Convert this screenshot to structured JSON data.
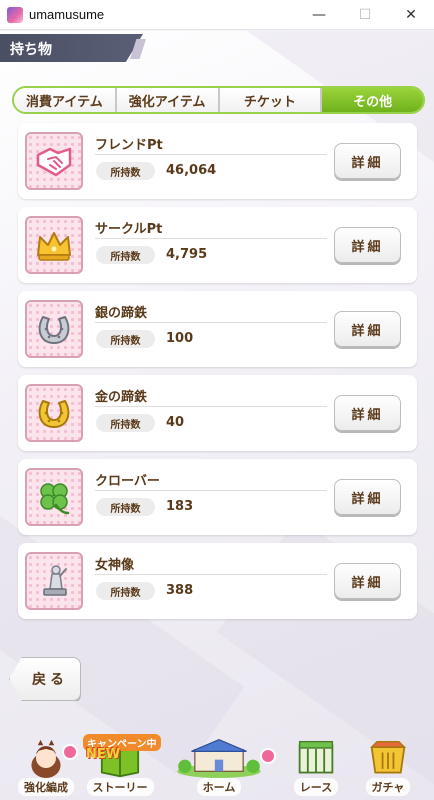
{
  "window": {
    "title": "umamusume",
    "minimize_glyph": "—",
    "maximize_glyph": "☐",
    "close_glyph": "✕"
  },
  "header": {
    "title": "持ち物"
  },
  "tabs": [
    {
      "label": "消費アイテム",
      "active": false
    },
    {
      "label": "強化アイテム",
      "active": false
    },
    {
      "label": "チケット",
      "active": false
    },
    {
      "label": "その他",
      "active": true
    }
  ],
  "items": [
    {
      "name": "フレンドPt",
      "owned_label": "所持数",
      "owned_value": "46,064",
      "detail_label": "詳細",
      "icon": "handshake-icon"
    },
    {
      "name": "サークルPt",
      "owned_label": "所持数",
      "owned_value": "4,795",
      "detail_label": "詳細",
      "icon": "crown-icon"
    },
    {
      "name": "銀の蹄鉄",
      "owned_label": "所持数",
      "owned_value": "100",
      "detail_label": "詳細",
      "icon": "silver-horseshoe-icon"
    },
    {
      "name": "金の蹄鉄",
      "owned_label": "所持数",
      "owned_value": "40",
      "detail_label": "詳細",
      "icon": "gold-horseshoe-icon"
    },
    {
      "name": "クローバー",
      "owned_label": "所持数",
      "owned_value": "183",
      "detail_label": "詳細",
      "icon": "clover-icon"
    },
    {
      "name": "女神像",
      "owned_label": "所持数",
      "owned_value": "388",
      "detail_label": "詳細",
      "icon": "goddess-statue-icon"
    }
  ],
  "back_button": {
    "label": "戻る"
  },
  "bottom_nav": [
    {
      "label": "強化編成",
      "icon": "character-icon"
    },
    {
      "label": "ストーリー",
      "icon": "book-icon",
      "badge": "キャンペーン中",
      "new": "NEW"
    },
    {
      "label": "ホーム",
      "icon": "home-building-icon"
    },
    {
      "label": "レース",
      "icon": "race-gate-icon"
    },
    {
      "label": "ガチャ",
      "icon": "gacha-icon"
    }
  ],
  "colors": {
    "accent_green": "#7cc226",
    "text_brown": "#5a3a1a",
    "header_dark": "#4a4f63",
    "notification_pink": "#f0679a"
  }
}
